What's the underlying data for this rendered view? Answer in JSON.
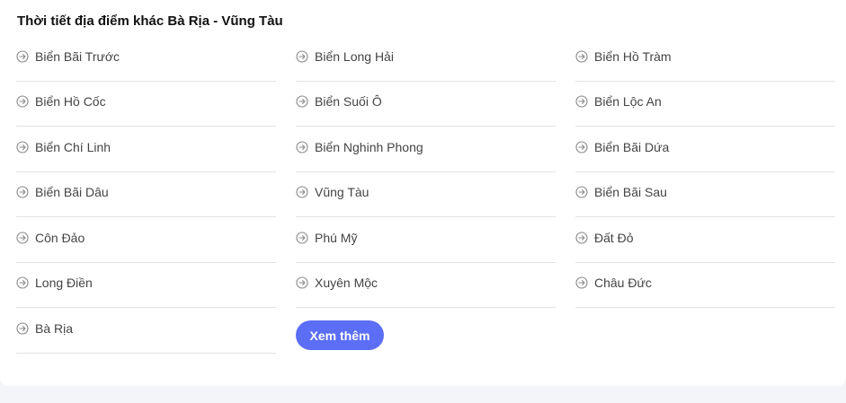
{
  "section": {
    "title": "Thời tiết địa điểm khác Bà Rịa - Vũng Tàu"
  },
  "columns": [
    [
      "Biển Bãi Trước",
      "Biển Hồ Cốc",
      "Biển Chí Linh",
      "Biển Bãi Dâu",
      "Côn Đảo",
      "Long Điền",
      "Bà Rịa"
    ],
    [
      "Biển Long Hải",
      "Biển Suối Ô",
      "Biển Nghinh Phong",
      "Vũng Tàu",
      "Phú Mỹ",
      "Xuyên Mộc"
    ],
    [
      "Biển Hồ Tràm",
      "Biển Lộc An",
      "Biển Bãi Dứa",
      "Biển Bãi Sau",
      "Đất Đỏ",
      "Châu Đức"
    ]
  ],
  "more_button": {
    "label": "Xem thêm"
  },
  "icons": {
    "item": "arrow-right-circle-icon"
  },
  "colors": {
    "accent": "#5b6ef5",
    "divider": "#e3e3e3",
    "icon": "#888888"
  }
}
